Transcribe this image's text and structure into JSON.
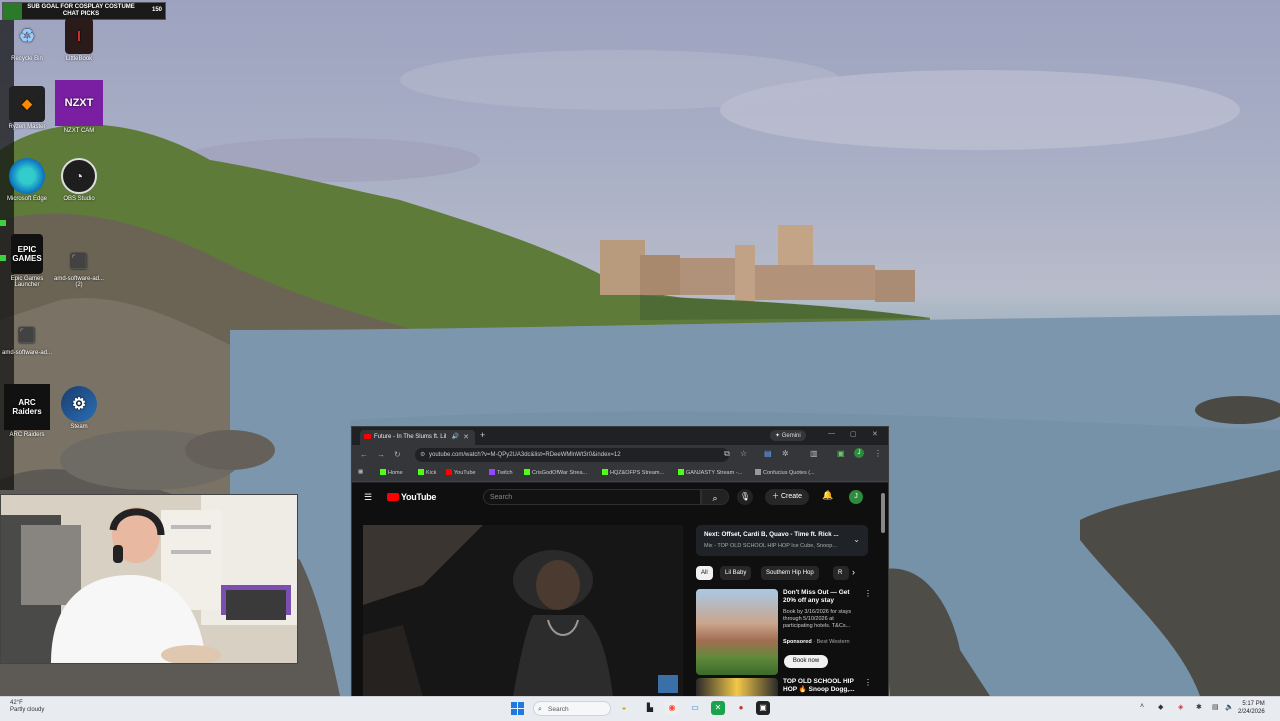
{
  "overlay": {
    "sub_goal_title": "SUB GOAL FOR COSPLAY COSTUME",
    "sub_goal_subtitle": "CHAT PICKS",
    "sub_goal_count": "150",
    "sub_goal_progress": 0.12
  },
  "desktop_icons": [
    {
      "label": "Recycle Bin",
      "icon": "recycle-bin-icon"
    },
    {
      "label": "LittleBook",
      "icon": "app-icon"
    },
    {
      "label": "Ryzen Master",
      "icon": "ryzen-master-icon"
    },
    {
      "label": "NZXT CAM",
      "icon": "nzxt-cam-icon",
      "text": "NZXT"
    },
    {
      "label": "Microsoft Edge",
      "icon": "edge-icon"
    },
    {
      "label": "OBS Studio",
      "icon": "obs-icon"
    },
    {
      "label": "Epic Games Launcher",
      "icon": "epic-games-icon",
      "text": "EPIC GAMES"
    },
    {
      "label": "amd-software-ad... (2)",
      "icon": "amd-installer-icon"
    },
    {
      "label": "amd-software-ad...",
      "icon": "amd-installer-icon"
    },
    {
      "label": "ARC Raiders",
      "icon": "arc-raiders-icon",
      "text": "ARC Raiders"
    },
    {
      "label": "Steam",
      "icon": "steam-icon"
    }
  ],
  "browser": {
    "tab_title": "Future - In The Slums ft. Lil",
    "gemini_label": "Gemini",
    "url": "youtube.com/watch?v=M-QPy2UA3dc&list=RDeeWMlnWt3r0&index=12",
    "bookmarks": [
      {
        "label": "Home",
        "color": "#53fc18"
      },
      {
        "label": "Kick",
        "color": "#53fc18"
      },
      {
        "label": "YouTube",
        "color": "#ff0000"
      },
      {
        "label": "Twitch",
        "color": "#9146ff"
      },
      {
        "label": "CrisGodOfWar Strea...",
        "color": "#53fc18"
      },
      {
        "label": "HQZ&OFPS Stream...",
        "color": "#53fc18"
      },
      {
        "label": "GANJASTY Stream -...",
        "color": "#53fc18"
      },
      {
        "label": "Confucius Quotes (...",
        "color": "#999999"
      }
    ]
  },
  "youtube": {
    "logo_text": "YouTube",
    "search_placeholder": "Search",
    "create_label": "Create",
    "avatar_letter": "J",
    "up_next_title": "Next: Offset, Cardi B, Quavo - Time ft. Rick ...",
    "up_next_sub": "Mix - TOP OLD SCHOOL HIP HOP Ice Cube, Snoop...",
    "chips": [
      "All",
      "Lil Baby",
      "Southern Hip Hop",
      "R"
    ],
    "ad": {
      "title": "Don't Miss Out — Get 20% off any stay",
      "description": "Book by 3/16/2026 for stays through 5/10/2026 at participating hotels. T&Cs...",
      "sponsored": "Sponsored",
      "advertiser": "Best Western",
      "button": "Book now"
    },
    "next_video_title": "TOP OLD SCHOOL HIP HOP 🔥 Snoop Dogg,..."
  },
  "taskbar": {
    "temperature": "42°F",
    "weather": "Partly cloudy",
    "search_placeholder": "Search",
    "time": "5:17 PM",
    "date": "2/24/2026"
  }
}
